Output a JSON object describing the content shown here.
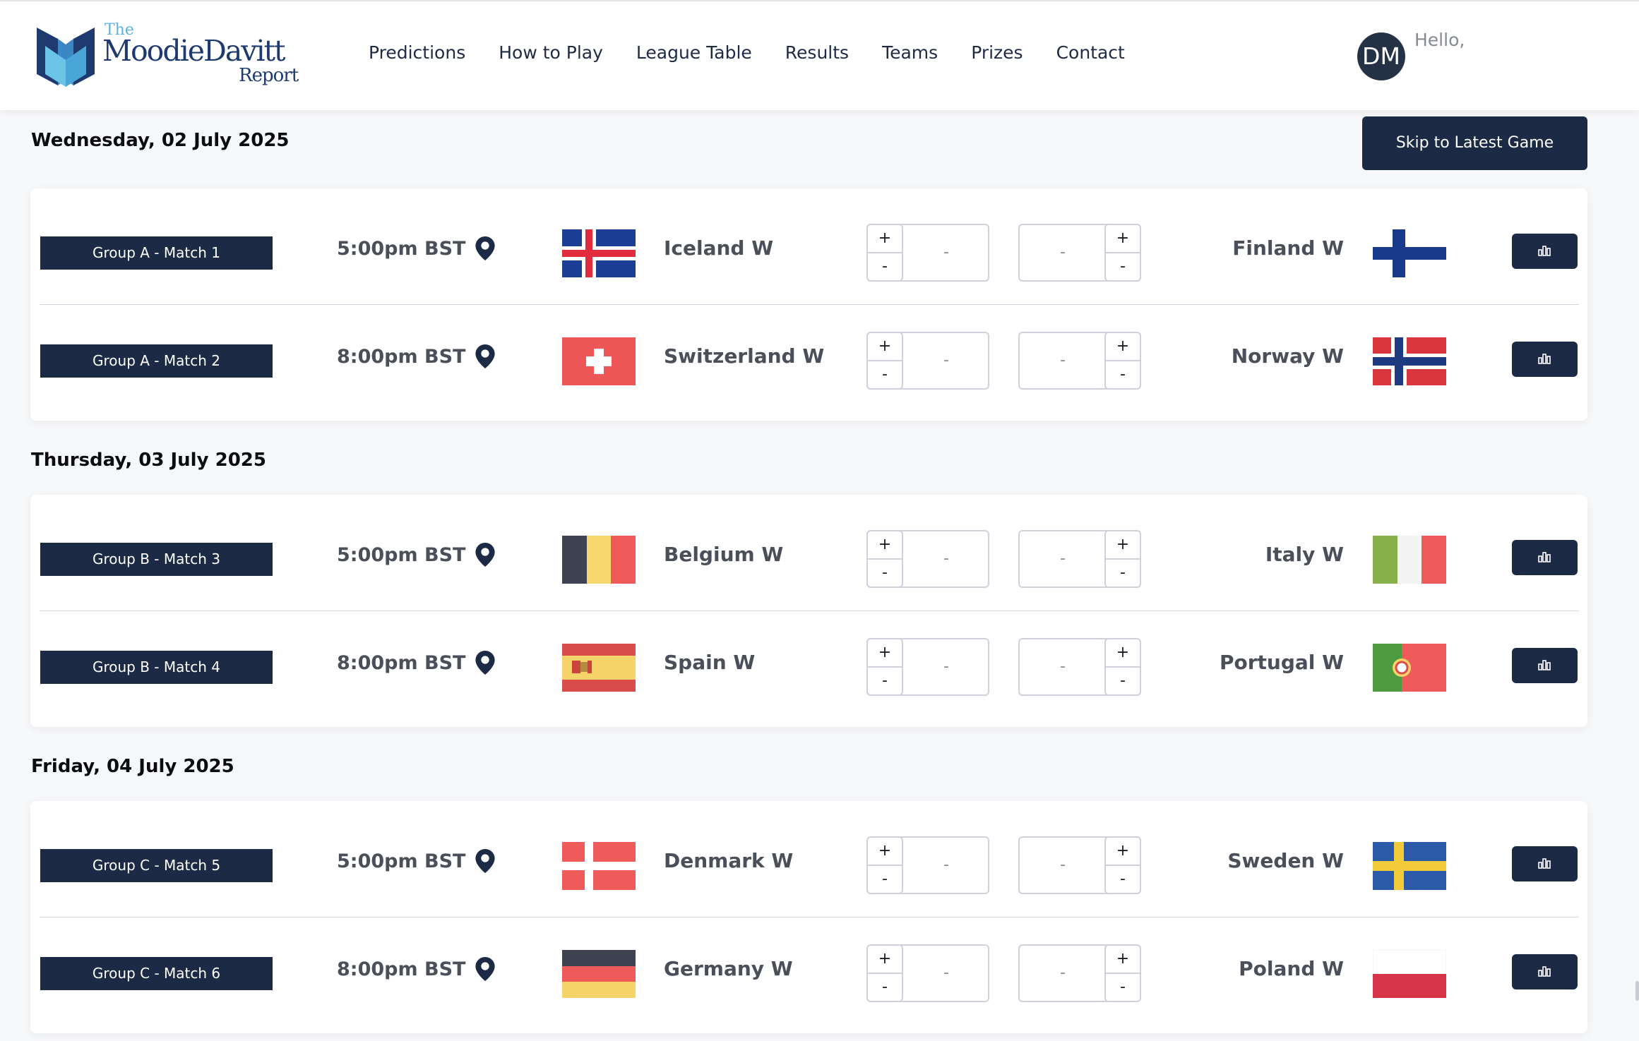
{
  "header": {
    "logo": {
      "the": "The",
      "name": "MoodieDavitt",
      "sub": "Report"
    },
    "nav": [
      "Predictions",
      "How to Play",
      "League Table",
      "Results",
      "Teams",
      "Prizes",
      "Contact"
    ],
    "avatar_initials": "DM",
    "greeting": "Hello,"
  },
  "skip_button": "Skip to Latest Game",
  "days": [
    {
      "title": "Wednesday, 02 July 2025",
      "matches": [
        {
          "label": "Group A - Match 1",
          "time": "5:00pm BST",
          "home": {
            "name": "Iceland W",
            "flag": "iceland",
            "score": "-"
          },
          "away": {
            "name": "Finland W",
            "flag": "finland",
            "score": "-"
          }
        },
        {
          "label": "Group A - Match 2",
          "time": "8:00pm BST",
          "home": {
            "name": "Switzerland W",
            "flag": "switzerland",
            "score": "-"
          },
          "away": {
            "name": "Norway W",
            "flag": "norway",
            "score": "-"
          }
        }
      ]
    },
    {
      "title": "Thursday, 03 July 2025",
      "matches": [
        {
          "label": "Group B - Match 3",
          "time": "5:00pm BST",
          "home": {
            "name": "Belgium W",
            "flag": "belgium",
            "score": "-"
          },
          "away": {
            "name": "Italy W",
            "flag": "italy",
            "score": "-"
          }
        },
        {
          "label": "Group B - Match 4",
          "time": "8:00pm BST",
          "home": {
            "name": "Spain W",
            "flag": "spain",
            "score": "-"
          },
          "away": {
            "name": "Portugal W",
            "flag": "portugal",
            "score": "-"
          }
        }
      ]
    },
    {
      "title": "Friday, 04 July 2025",
      "matches": [
        {
          "label": "Group C - Match 5",
          "time": "5:00pm BST",
          "home": {
            "name": "Denmark W",
            "flag": "denmark",
            "score": "-"
          },
          "away": {
            "name": "Sweden W",
            "flag": "sweden",
            "score": "-"
          }
        },
        {
          "label": "Group C - Match 6",
          "time": "8:00pm BST",
          "home": {
            "name": "Germany W",
            "flag": "germany",
            "score": "-"
          },
          "away": {
            "name": "Poland W",
            "flag": "poland",
            "score": "-"
          }
        }
      ]
    }
  ],
  "stepper": {
    "plus": "+",
    "minus": "-"
  },
  "icons": {
    "venue": "map-pin-icon",
    "stats": "bar-chart-icon"
  },
  "colors": {
    "navy": "#1c2a45",
    "team_text": "#4a4f5a",
    "logo_blue": "#1e3a6e",
    "logo_light": "#5bb4dd"
  }
}
